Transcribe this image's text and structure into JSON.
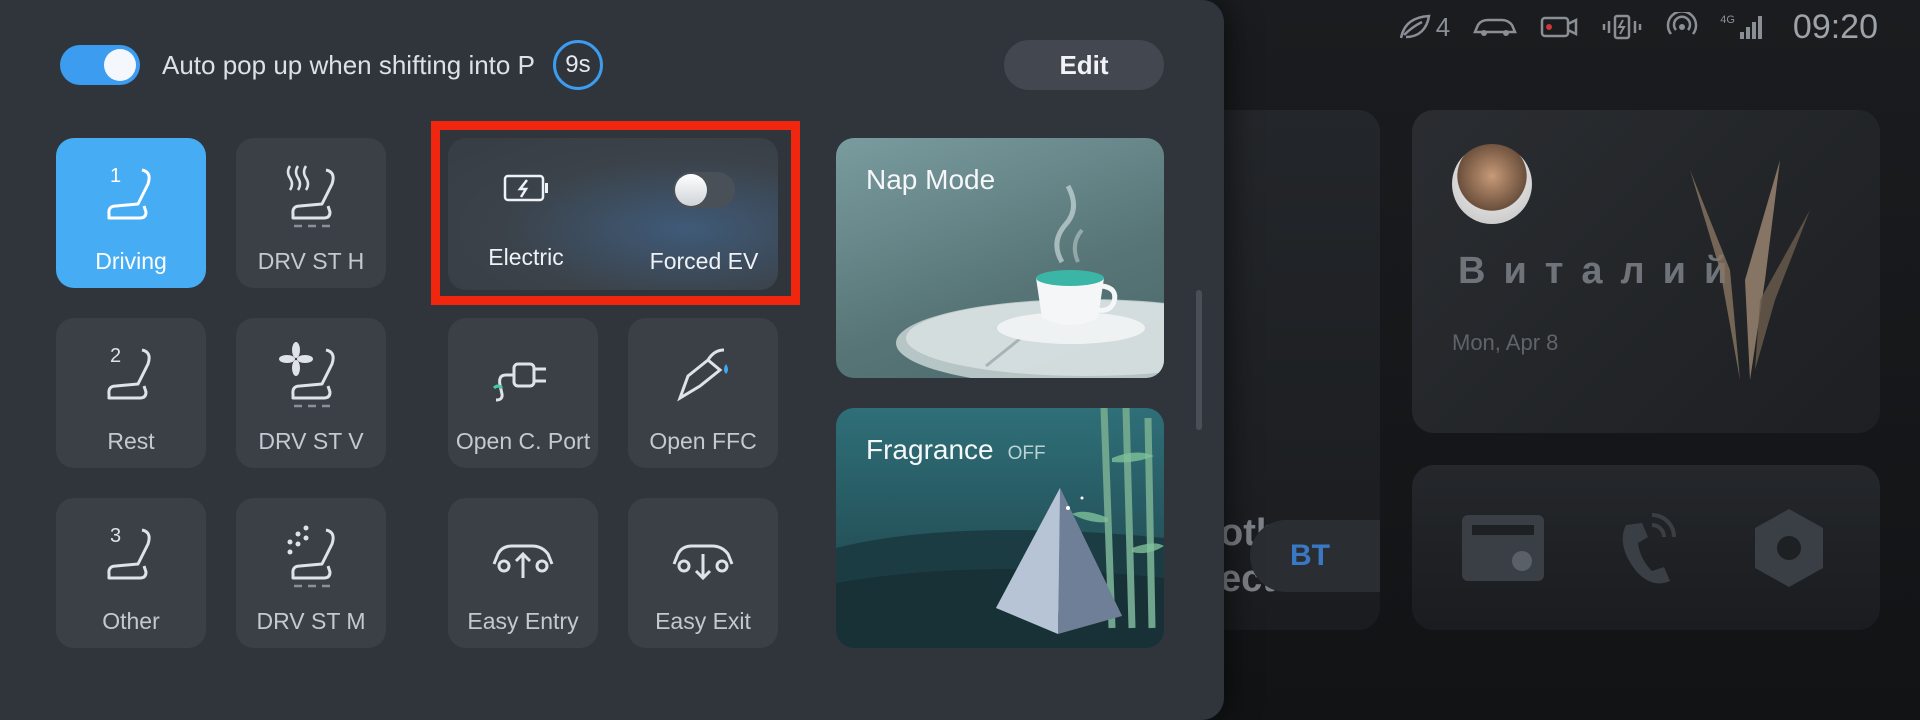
{
  "status_bar": {
    "eco_count": "4",
    "network_label": "4G",
    "time": "09:20"
  },
  "background": {
    "bluetooth_text_line1": "oth",
    "bluetooth_text_line2": "ected",
    "bluetooth_button": "BT",
    "user_name": "Виталий",
    "user_date": "Mon, Apr 8"
  },
  "panel": {
    "auto_popup_label": "Auto pop up when shifting into P",
    "timer": "9s",
    "edit_label": "Edit",
    "seat_tiles": [
      {
        "label": "Driving",
        "number": "1",
        "icon": "seat-icon",
        "active": true
      },
      {
        "label": "DRV ST H",
        "icon": "seat-heat-icon",
        "active": false
      },
      {
        "label": "Rest",
        "number": "2",
        "icon": "seat-icon",
        "active": false
      },
      {
        "label": "DRV ST V",
        "icon": "seat-vent-icon",
        "active": false
      },
      {
        "label": "Other",
        "number": "3",
        "icon": "seat-icon",
        "active": false
      },
      {
        "label": "DRV ST M",
        "icon": "seat-massage-icon",
        "active": false
      }
    ],
    "ev": {
      "electric_label": "Electric",
      "forced_ev_label": "Forced EV",
      "forced_ev_on": false
    },
    "action_tiles": [
      {
        "label": "Open C. Port",
        "icon": "charge-plug-icon"
      },
      {
        "label": "Open FFC",
        "icon": "fuel-cap-icon"
      },
      {
        "label": "Easy Entry",
        "icon": "car-raise-icon"
      },
      {
        "label": "Easy Exit",
        "icon": "car-lower-icon"
      }
    ],
    "nap_mode_label": "Nap Mode",
    "fragrance_label": "Fragrance",
    "fragrance_state": "OFF"
  },
  "colors": {
    "accent": "#46adf5",
    "panel_bg": "#30353c",
    "tile_bg": "#3b4047",
    "highlight": "#f0260f"
  }
}
